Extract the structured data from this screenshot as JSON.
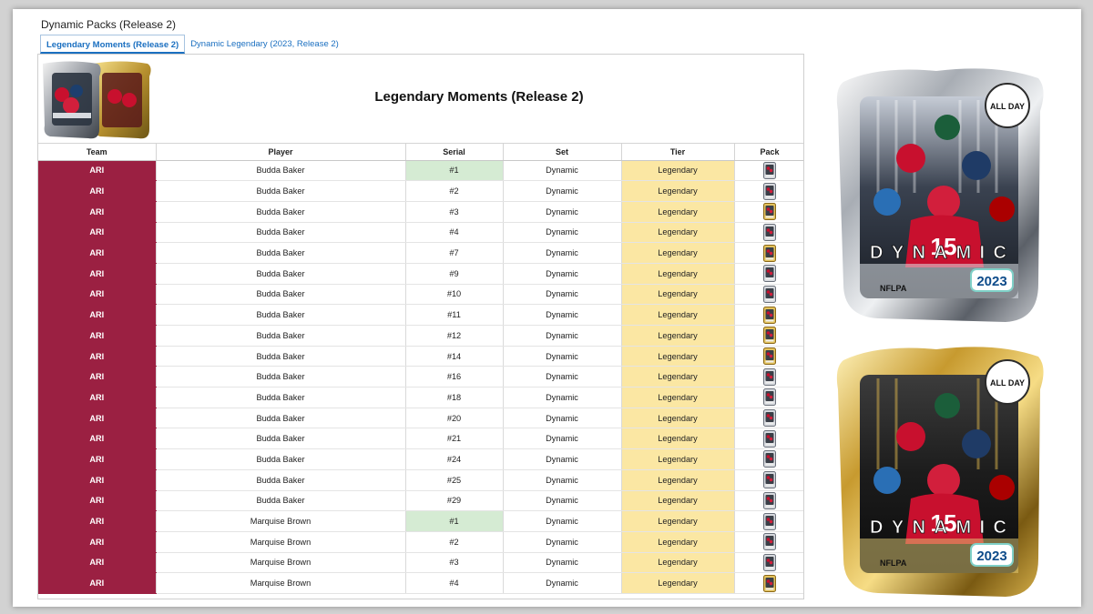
{
  "document": {
    "title": "Dynamic Packs (Release 2)"
  },
  "tabs": [
    {
      "label": "Legendary Moments (Release 2)",
      "active": true
    },
    {
      "label": "Dynamic Legendary (2023, Release 2)",
      "active": false
    }
  ],
  "banner": {
    "title": "Legendary Moments (Release 2)"
  },
  "columns": {
    "team": "Team",
    "player": "Player",
    "serial": "Serial",
    "set": "Set",
    "tier": "Tier",
    "pack": "Pack"
  },
  "rows": [
    {
      "team": "ARI",
      "player": "Budda Baker",
      "serial": "#1",
      "set": "Dynamic",
      "tier": "Legendary",
      "first_serial": true,
      "pack": "silver"
    },
    {
      "team": "ARI",
      "player": "Budda Baker",
      "serial": "#2",
      "set": "Dynamic",
      "tier": "Legendary",
      "first_serial": false,
      "pack": "silver"
    },
    {
      "team": "ARI",
      "player": "Budda Baker",
      "serial": "#3",
      "set": "Dynamic",
      "tier": "Legendary",
      "first_serial": false,
      "pack": "gold"
    },
    {
      "team": "ARI",
      "player": "Budda Baker",
      "serial": "#4",
      "set": "Dynamic",
      "tier": "Legendary",
      "first_serial": false,
      "pack": "silver"
    },
    {
      "team": "ARI",
      "player": "Budda Baker",
      "serial": "#7",
      "set": "Dynamic",
      "tier": "Legendary",
      "first_serial": false,
      "pack": "gold"
    },
    {
      "team": "ARI",
      "player": "Budda Baker",
      "serial": "#9",
      "set": "Dynamic",
      "tier": "Legendary",
      "first_serial": false,
      "pack": "silver"
    },
    {
      "team": "ARI",
      "player": "Budda Baker",
      "serial": "#10",
      "set": "Dynamic",
      "tier": "Legendary",
      "first_serial": false,
      "pack": "silver"
    },
    {
      "team": "ARI",
      "player": "Budda Baker",
      "serial": "#11",
      "set": "Dynamic",
      "tier": "Legendary",
      "first_serial": false,
      "pack": "gold"
    },
    {
      "team": "ARI",
      "player": "Budda Baker",
      "serial": "#12",
      "set": "Dynamic",
      "tier": "Legendary",
      "first_serial": false,
      "pack": "gold"
    },
    {
      "team": "ARI",
      "player": "Budda Baker",
      "serial": "#14",
      "set": "Dynamic",
      "tier": "Legendary",
      "first_serial": false,
      "pack": "gold"
    },
    {
      "team": "ARI",
      "player": "Budda Baker",
      "serial": "#16",
      "set": "Dynamic",
      "tier": "Legendary",
      "first_serial": false,
      "pack": "silver"
    },
    {
      "team": "ARI",
      "player": "Budda Baker",
      "serial": "#18",
      "set": "Dynamic",
      "tier": "Legendary",
      "first_serial": false,
      "pack": "silver"
    },
    {
      "team": "ARI",
      "player": "Budda Baker",
      "serial": "#20",
      "set": "Dynamic",
      "tier": "Legendary",
      "first_serial": false,
      "pack": "silver"
    },
    {
      "team": "ARI",
      "player": "Budda Baker",
      "serial": "#21",
      "set": "Dynamic",
      "tier": "Legendary",
      "first_serial": false,
      "pack": "silver"
    },
    {
      "team": "ARI",
      "player": "Budda Baker",
      "serial": "#24",
      "set": "Dynamic",
      "tier": "Legendary",
      "first_serial": false,
      "pack": "silver"
    },
    {
      "team": "ARI",
      "player": "Budda Baker",
      "serial": "#25",
      "set": "Dynamic",
      "tier": "Legendary",
      "first_serial": false,
      "pack": "silver"
    },
    {
      "team": "ARI",
      "player": "Budda Baker",
      "serial": "#29",
      "set": "Dynamic",
      "tier": "Legendary",
      "first_serial": false,
      "pack": "silver"
    },
    {
      "team": "ARI",
      "player": "Marquise Brown",
      "serial": "#1",
      "set": "Dynamic",
      "tier": "Legendary",
      "first_serial": true,
      "pack": "silver"
    },
    {
      "team": "ARI",
      "player": "Marquise Brown",
      "serial": "#2",
      "set": "Dynamic",
      "tier": "Legendary",
      "first_serial": false,
      "pack": "silver"
    },
    {
      "team": "ARI",
      "player": "Marquise Brown",
      "serial": "#3",
      "set": "Dynamic",
      "tier": "Legendary",
      "first_serial": false,
      "pack": "silver"
    },
    {
      "team": "ARI",
      "player": "Marquise Brown",
      "serial": "#4",
      "set": "Dynamic",
      "tier": "Legendary",
      "first_serial": false,
      "pack": "gold"
    }
  ],
  "pack_art": {
    "silver": {
      "brand": "DYNAMIC",
      "badge": "ALL DAY",
      "league": "NFLPA",
      "year": "2023",
      "jersey": "15"
    },
    "gold": {
      "brand": "DYNAMIC",
      "badge": "ALL DAY",
      "league": "NFLPA",
      "year": "2023",
      "jersey": "15"
    }
  },
  "colors": {
    "team_arizona": "#9b2042",
    "tier_legendary": "#fbe7a3",
    "first_serial": "#d5ebd3",
    "tab_link": "#1a6fc0"
  }
}
